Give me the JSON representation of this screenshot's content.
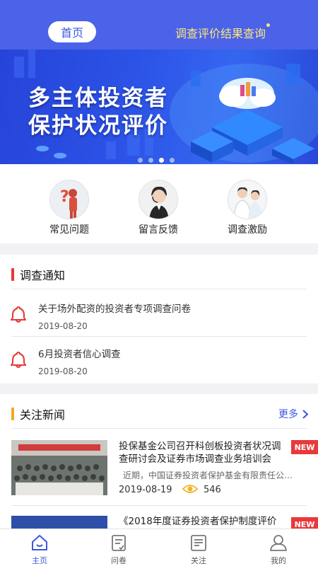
{
  "header": {
    "home_label": "首页",
    "query_link": "调查评价结果查询"
  },
  "banner": {
    "title_line1": "多主体投资者",
    "title_line2": "保护状况评价",
    "slide_count": 4,
    "active_slide": 3
  },
  "quick_menu": [
    {
      "label": "常见问题",
      "icon": "question-person-icon"
    },
    {
      "label": "留言反馈",
      "icon": "headset-agent-icon"
    },
    {
      "label": "调查激励",
      "icon": "two-people-icon"
    }
  ],
  "notice": {
    "title": "调查通知",
    "accent": "#e53935",
    "items": [
      {
        "title": "关于场外配资的投资者专项调查问卷",
        "date": "2019-08-20"
      },
      {
        "title": "6月投资者信心调查",
        "date": "2019-08-20"
      }
    ]
  },
  "news": {
    "title": "关注新闻",
    "accent": "#f5a623",
    "more_label": "更多",
    "items": [
      {
        "title": "投保基金公司召开科创板投资者状况调查研讨会及证券市场调查业务培训会",
        "summary": "近期，中国证券投资者保护基金有限责任公司（...",
        "date": "2019-08-19",
        "views": "546",
        "badge": "NEW"
      },
      {
        "title": "《2018年度证券投资者保护制度评价",
        "badge": "NEW"
      }
    ]
  },
  "tabs": [
    {
      "label": "主页",
      "icon": "home-icon",
      "active": true
    },
    {
      "label": "问卷",
      "icon": "questionnaire-icon",
      "active": false
    },
    {
      "label": "关注",
      "icon": "news-icon",
      "active": false
    },
    {
      "label": "我的",
      "icon": "user-icon",
      "active": false
    }
  ],
  "colors": {
    "primary": "#4a63e8",
    "highlight": "#ffe77a",
    "badge": "#e8393b"
  }
}
